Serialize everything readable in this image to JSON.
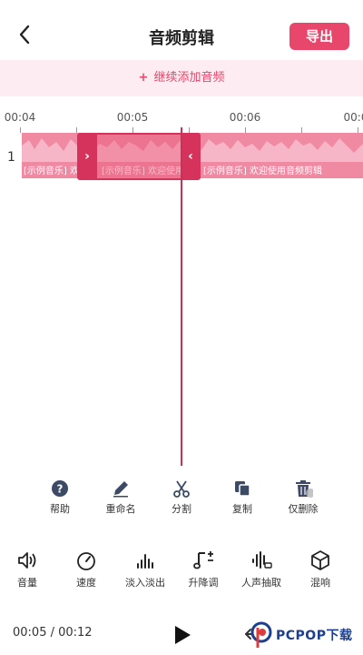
{
  "header": {
    "back_icon": "chevron-left-icon",
    "title": "音频剪辑",
    "export_label": "导出"
  },
  "add_audio": {
    "plus": "+",
    "label": "继续添加音频"
  },
  "ruler": {
    "ticks": [
      "00:04",
      "00:05",
      "00:06",
      "00:0"
    ]
  },
  "track": {
    "number": "1",
    "clips": [
      "[示例音乐] 欢",
      "[示例音乐] 欢迎使用",
      "[示例音乐] 欢迎使用音频剪辑"
    ],
    "colors": {
      "wave": "#f08aa3",
      "selection": "#d6335c",
      "accent": "#e8466b"
    }
  },
  "tools": [
    {
      "icon": "help-icon",
      "label": "帮助"
    },
    {
      "icon": "pencil-icon",
      "label": "重命名"
    },
    {
      "icon": "scissors-icon",
      "label": "分割"
    },
    {
      "icon": "copy-icon",
      "label": "复制"
    },
    {
      "icon": "trash-icon",
      "label": "仅删除"
    }
  ],
  "bottom_tools": [
    {
      "icon": "volume-icon",
      "label": "音量"
    },
    {
      "icon": "speed-gauge-icon",
      "label": "速度"
    },
    {
      "icon": "fade-bars-icon",
      "label": "淡入淡出"
    },
    {
      "icon": "pitch-note-icon",
      "label": "升降调"
    },
    {
      "icon": "vocal-extract-icon",
      "label": "人声抽取"
    },
    {
      "icon": "mix-cube-icon",
      "label": "混响"
    }
  ],
  "playback": {
    "time": "00:05 / 00:12",
    "play_icon": "play-icon",
    "undo_icon": "undo-icon"
  },
  "watermark": {
    "text": "PCPOP下载"
  }
}
